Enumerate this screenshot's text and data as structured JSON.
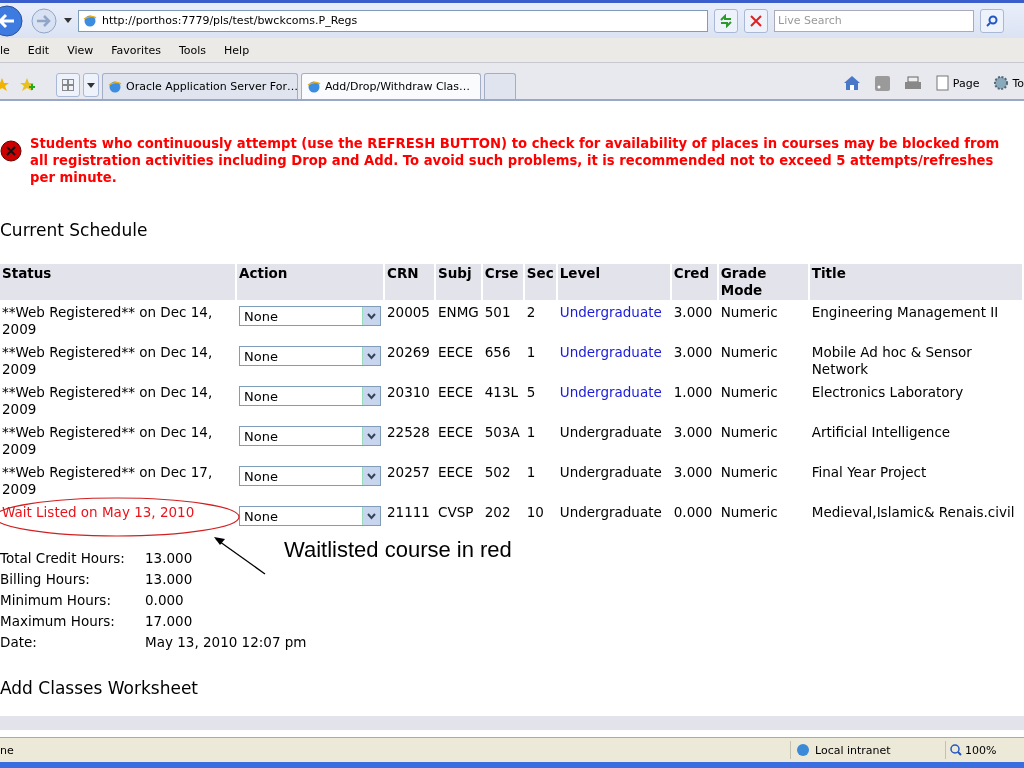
{
  "browser": {
    "address": "http://porthos:7779/pls/test/bwckcoms.P_Regs",
    "search": {
      "placeholder": "Live Search"
    },
    "menu": [
      "le",
      "Edit",
      "View",
      "Favorites",
      "Tools",
      "Help"
    ],
    "tabs": [
      {
        "label": "Oracle Application Server For…",
        "selected": false
      },
      {
        "label": "Add/Drop/Withdraw Clas…",
        "selected": true
      }
    ],
    "commands": [
      "Page",
      "To"
    ]
  },
  "warning": "Students who continuously attempt (use the REFRESH BUTTON) to check for availability of places in courses may be blocked from all registration activities including Drop and Add. To avoid such problems, it is recommended not to exceed 5 attempts/refreshes per minute.",
  "schedule": {
    "title": "Current Schedule",
    "columns": [
      "Status",
      "Action",
      "CRN",
      "Subj",
      "Crse",
      "Sec",
      "Level",
      "Cred",
      "Grade Mode",
      "Title"
    ],
    "rows": [
      {
        "status": "**Web Registered** on Dec 14, 2009",
        "kind": "registered",
        "action": "None",
        "crn": "20005",
        "subj": "ENMG",
        "crse": "501",
        "sec": "2",
        "level": "Undergraduate",
        "level_link": true,
        "cred": "3.000",
        "grade_mode": "Numeric",
        "title": "Engineering Management II"
      },
      {
        "status": "**Web Registered** on Dec 14, 2009",
        "kind": "registered",
        "action": "None",
        "crn": "20269",
        "subj": "EECE",
        "crse": "656",
        "sec": "1",
        "level": "Undergraduate",
        "level_link": true,
        "cred": "3.000",
        "grade_mode": "Numeric",
        "title": "Mobile Ad hoc & Sensor Network"
      },
      {
        "status": "**Web Registered** on Dec 14, 2009",
        "kind": "registered",
        "action": "None",
        "crn": "20310",
        "subj": "EECE",
        "crse": "413L",
        "sec": "5",
        "level": "Undergraduate",
        "level_link": true,
        "cred": "1.000",
        "grade_mode": "Numeric",
        "title": "Electronics Laboratory"
      },
      {
        "status": "**Web Registered** on Dec 14, 2009",
        "kind": "registered",
        "action": "None",
        "crn": "22528",
        "subj": "EECE",
        "crse": "503A",
        "sec": "1",
        "level": "Undergraduate",
        "level_link": false,
        "cred": "3.000",
        "grade_mode": "Numeric",
        "title": "Artificial Intelligence"
      },
      {
        "status": "**Web Registered** on Dec 17, 2009",
        "kind": "registered",
        "action": "None",
        "crn": "20257",
        "subj": "EECE",
        "crse": "502",
        "sec": "1",
        "level": "Undergraduate",
        "level_link": false,
        "cred": "3.000",
        "grade_mode": "Numeric",
        "title": "Final Year Project"
      },
      {
        "status": "Wait Listed on May 13, 2010",
        "kind": "waitlisted",
        "action": "None",
        "crn": "21111",
        "subj": "CVSP",
        "crse": "202",
        "sec": "10",
        "level": "Undergraduate",
        "level_link": false,
        "cred": "0.000",
        "grade_mode": "Numeric",
        "title": "Medieval,Islamic& Renais.civil"
      }
    ]
  },
  "annotation": "Waitlisted course in red",
  "summary": [
    {
      "label": "Total Credit Hours:",
      "value": "13.000"
    },
    {
      "label": "Billing Hours:",
      "value": "13.000"
    },
    {
      "label": "Minimum Hours:",
      "value": "0.000"
    },
    {
      "label": "Maximum Hours:",
      "value": "17.000"
    },
    {
      "label": "Date:",
      "value": "May 13, 2010 12:07 pm"
    }
  ],
  "worksheet": {
    "title": "Add Classes Worksheet"
  },
  "status_bar": {
    "text": "ne",
    "zone": "Local intranet",
    "zoom": "100%"
  }
}
